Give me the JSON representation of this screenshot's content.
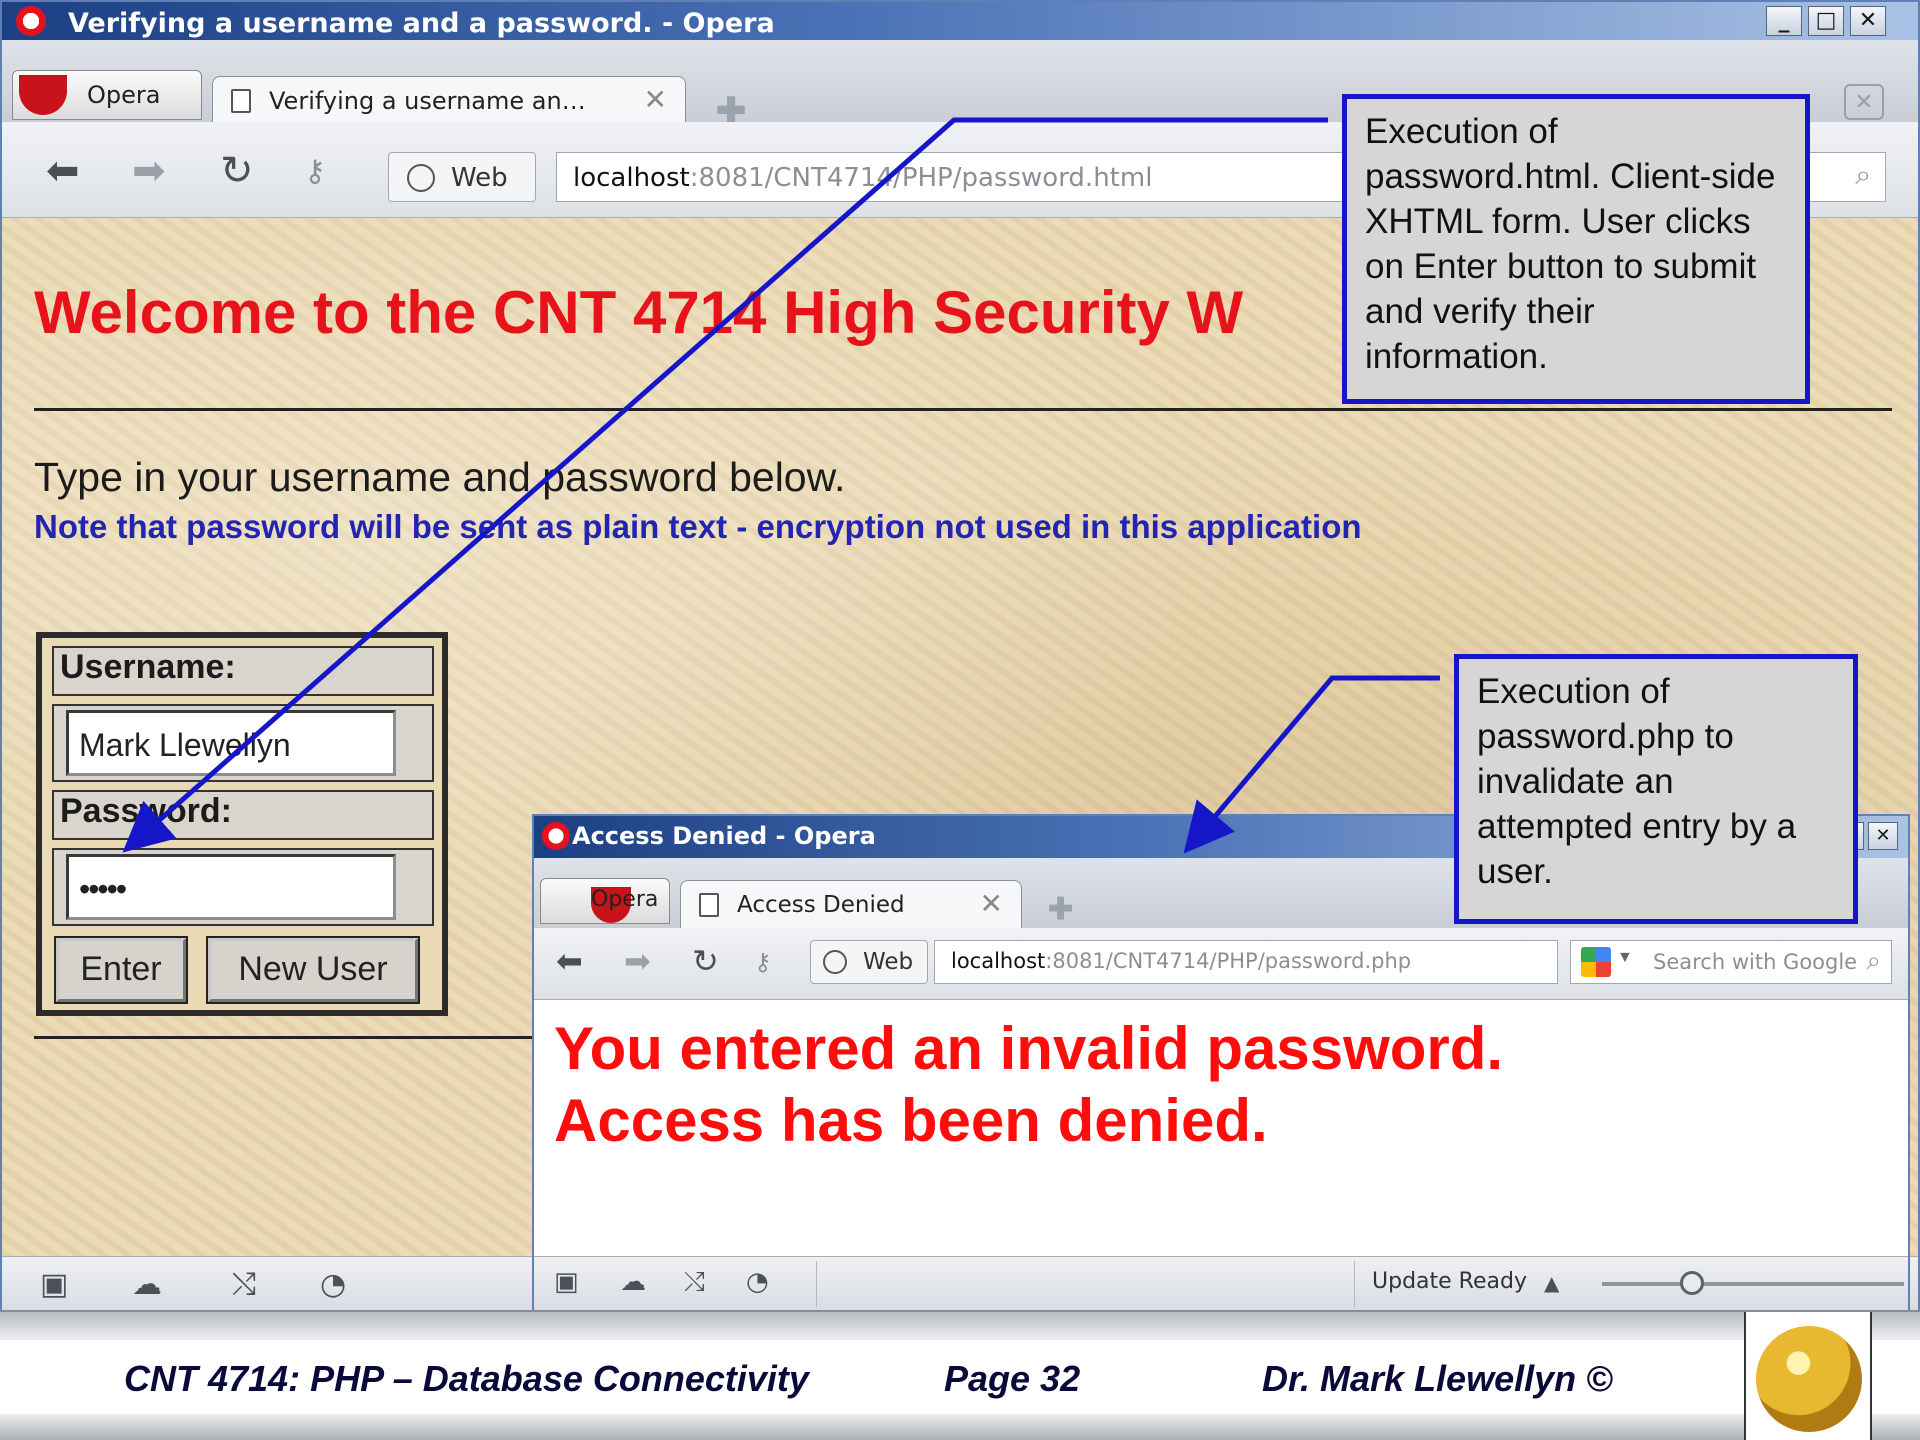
{
  "main_window": {
    "title": "Verifying a username and a password. - Opera",
    "opera_menu_label": "Opera",
    "tab_label": "Verifying a username an…",
    "tab_close": "✕",
    "nav": {
      "web_label": "Web",
      "url_host": "localhost",
      "url_path": ":8081/CNT4714/PHP/password.html"
    },
    "page": {
      "heading": "Welcome to the CNT 4714 High Security W",
      "instruction": "Type in your username and password below.",
      "note": "Note that password will be sent as plain text - encryption not used in this application",
      "form": {
        "username_label": "Username:",
        "username_value": "Mark Llewellyn",
        "password_label": "Password:",
        "password_value": "•••••",
        "enter_button": "Enter",
        "new_user_button": "New User"
      }
    }
  },
  "popup_window": {
    "title": "Access Denied - Opera",
    "opera_menu_label": "Opera",
    "tab_label": "Access Denied",
    "tab_close": "✕",
    "nav": {
      "web_label": "Web",
      "url_host": "localhost",
      "url_path": ":8081/CNT4714/PHP/password.php",
      "search_placeholder": "Search with Google"
    },
    "message_line1": "You entered an invalid password.",
    "message_line2": "Access has been denied.",
    "status": {
      "update_text": "Update Ready"
    }
  },
  "callouts": {
    "callout1": "Execution of password.html.  Client-side XHTML form.  User clicks on Enter button to submit and verify their information.",
    "callout2": "Execution of password.php to invalidate an attempted entry by a user."
  },
  "footer": {
    "course": "CNT 4714:  PHP – Database Connectivity",
    "page": "Page 32",
    "author": "Dr. Mark Llewellyn ©"
  },
  "colors": {
    "heading_red": "#e8121b",
    "note_blue": "#2424b3",
    "callout_border": "#1616c9",
    "error_red": "#ff0d0d"
  },
  "icons": [
    "back-icon",
    "forward-icon",
    "reload-icon",
    "key-icon",
    "globe-icon",
    "search-icon",
    "page-icon",
    "new-tab-icon",
    "trash-icon",
    "panel-icon",
    "cloud-icon",
    "unite-icon",
    "speed-dial-icon",
    "google-icon",
    "opera-logo-icon",
    "ucf-logo-icon"
  ]
}
